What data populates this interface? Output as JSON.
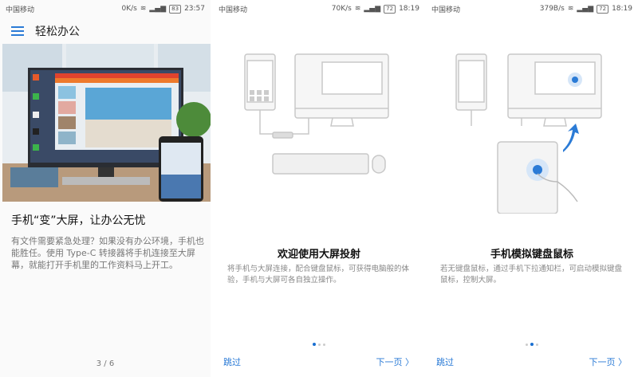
{
  "panels": [
    {
      "status": {
        "carrier": "中国移动",
        "speed": "0K/s",
        "battery": "83",
        "time": "23:57"
      },
      "header": {
        "title": "轻松办公"
      },
      "title": "手机“变”大屏，让办公无忧",
      "body": "有文件需要紧急处理？如果没有办公环境，手机也能胜任。使用 Type-C 转接器将手机连接至大屏幕，就能打开手机里的工作资料马上开工。",
      "pager": "3 / 6"
    },
    {
      "status": {
        "carrier": "中国移动",
        "speed": "70K/s",
        "battery": "72",
        "time": "18:19"
      },
      "title": "欢迎使用大屏投射",
      "desc": "将手机与大屏连接，配合键盘鼠标，可获得电脑般的体验，手机与大屏可各自独立操作。",
      "skip": "跳过",
      "next": "下一页",
      "active_dot": 0
    },
    {
      "status": {
        "carrier": "中国移动",
        "speed": "379B/s",
        "battery": "72",
        "time": "18:19"
      },
      "title": "手机模拟键盘鼠标",
      "desc": "若无键盘鼠标，通过手机下拉通知栏，可启动模拟键盘鼠标，控制大屏。",
      "skip": "跳过",
      "next": "下一页",
      "active_dot": 1
    }
  ],
  "colors": {
    "accent": "#2b7bd6"
  }
}
